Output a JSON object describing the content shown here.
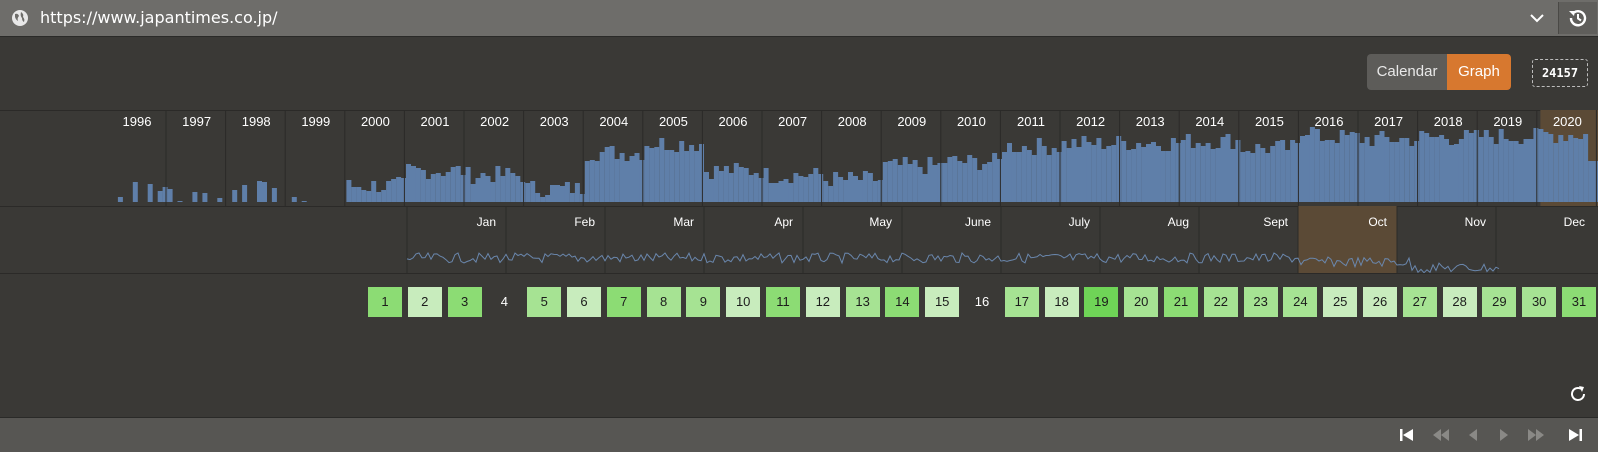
{
  "url_bar": {
    "url": "https://www.japantimes.co.jp/"
  },
  "view_toggle": {
    "calendar_label": "Calendar",
    "graph_label": "Graph",
    "active": "Graph"
  },
  "capture_count": "24157",
  "years": [
    "1996",
    "1997",
    "1998",
    "1999",
    "2000",
    "2001",
    "2002",
    "2003",
    "2004",
    "2005",
    "2006",
    "2007",
    "2008",
    "2009",
    "2010",
    "2011",
    "2012",
    "2013",
    "2014",
    "2015",
    "2016",
    "2017",
    "2018",
    "2019",
    "2020"
  ],
  "selected_year": "2020",
  "months": [
    "Jan",
    "Feb",
    "Mar",
    "Apr",
    "May",
    "June",
    "July",
    "Aug",
    "Sept",
    "Oct",
    "Nov",
    "Dec"
  ],
  "selected_month": "Oct",
  "days": [
    {
      "label": "1",
      "level": 3
    },
    {
      "label": "2",
      "level": 1
    },
    {
      "label": "3",
      "level": 3
    },
    {
      "label": "4",
      "level": 0
    },
    {
      "label": "5",
      "level": 2
    },
    {
      "label": "6",
      "level": 1
    },
    {
      "label": "7",
      "level": 3
    },
    {
      "label": "8",
      "level": 2
    },
    {
      "label": "9",
      "level": 2
    },
    {
      "label": "10",
      "level": 1
    },
    {
      "label": "11",
      "level": 3
    },
    {
      "label": "12",
      "level": 1
    },
    {
      "label": "13",
      "level": 2
    },
    {
      "label": "14",
      "level": 3
    },
    {
      "label": "15",
      "level": 1
    },
    {
      "label": "16",
      "level": 0
    },
    {
      "label": "17",
      "level": 2
    },
    {
      "label": "18",
      "level": 1
    },
    {
      "label": "19",
      "level": 4
    },
    {
      "label": "20",
      "level": 2
    },
    {
      "label": "21",
      "level": 3
    },
    {
      "label": "22",
      "level": 2
    },
    {
      "label": "23",
      "level": 2
    },
    {
      "label": "24",
      "level": 2
    },
    {
      "label": "25",
      "level": 1
    },
    {
      "label": "26",
      "level": 1
    },
    {
      "label": "27",
      "level": 2
    },
    {
      "label": "28",
      "level": 1
    },
    {
      "label": "29",
      "level": 2
    },
    {
      "label": "30",
      "level": 2
    },
    {
      "label": "31",
      "level": 3
    }
  ],
  "colors": {
    "bar": "#5f7fa9",
    "highlight": "#5b4a36",
    "accent": "#d7782f",
    "day_levels": [
      "transparent",
      "#c8ecbd",
      "#a6e393",
      "#8cdc74",
      "#6fd457"
    ]
  },
  "icons": {
    "globe": "globe-icon",
    "chevron": "chevron-down-icon",
    "history": "history-icon",
    "refresh": "refresh-icon",
    "nav": [
      "first-icon",
      "rewind-icon",
      "prev-icon",
      "next-icon",
      "fast-forward-icon",
      "last-icon"
    ]
  }
}
